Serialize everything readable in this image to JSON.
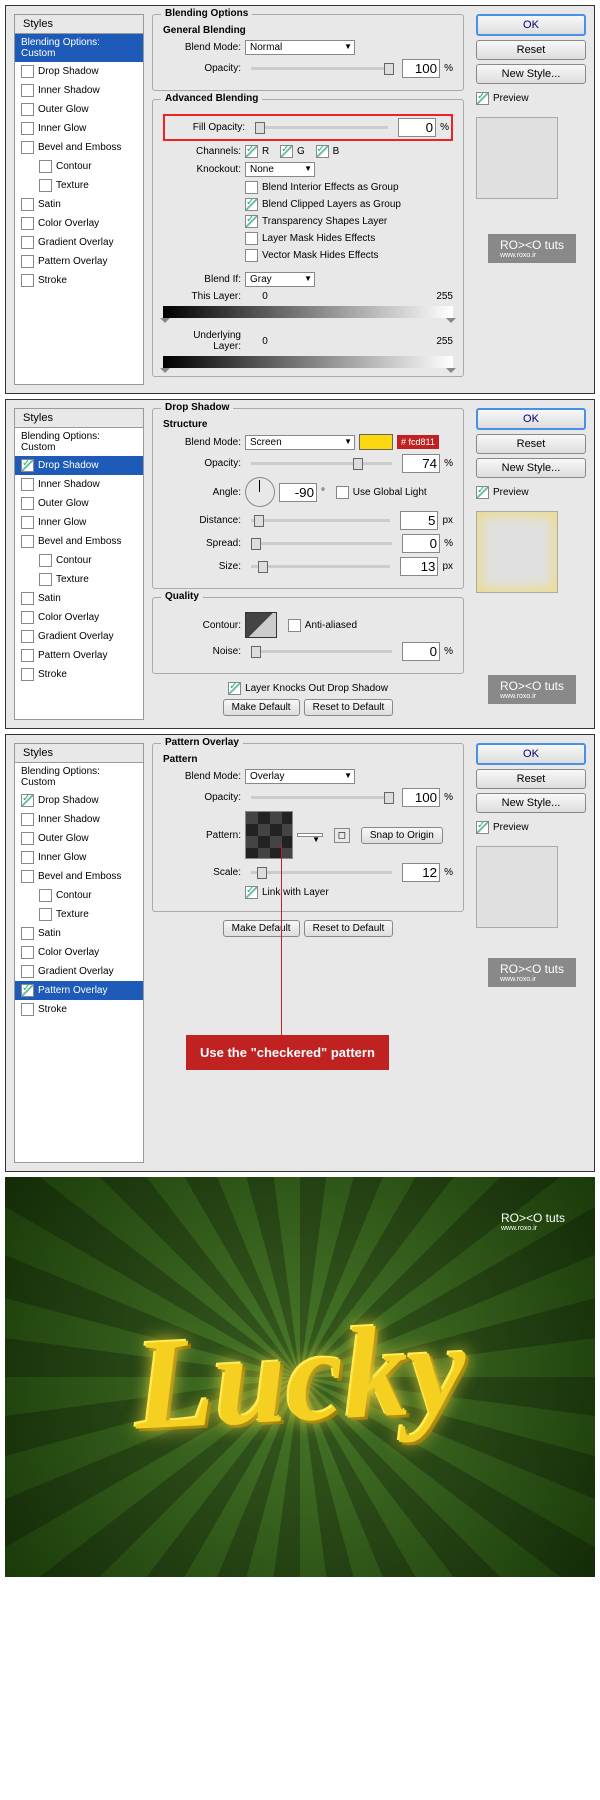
{
  "sidebar": {
    "header": "Styles",
    "items": [
      {
        "label": "Blending Options: Custom"
      },
      {
        "label": "Drop Shadow"
      },
      {
        "label": "Inner Shadow"
      },
      {
        "label": "Outer Glow"
      },
      {
        "label": "Inner Glow"
      },
      {
        "label": "Bevel and Emboss"
      },
      {
        "label": "Contour"
      },
      {
        "label": "Texture"
      },
      {
        "label": "Satin"
      },
      {
        "label": "Color Overlay"
      },
      {
        "label": "Gradient Overlay"
      },
      {
        "label": "Pattern Overlay"
      },
      {
        "label": "Stroke"
      }
    ]
  },
  "buttons": {
    "ok": "OK",
    "reset": "Reset",
    "newStyle": "New Style...",
    "preview": "Preview",
    "makeDef": "Make Default",
    "resetDef": "Reset to Default",
    "snap": "Snap to Origin"
  },
  "p1": {
    "t1": "Blending Options",
    "t2": "General Blending",
    "t3": "Advanced Blending",
    "blendMode": "Blend Mode:",
    "bmVal": "Normal",
    "opacity": "Opacity:",
    "opVal": "100",
    "pct": "%",
    "fillOp": "Fill Opacity:",
    "fillVal": "0",
    "channels": "Channels:",
    "r": "R",
    "g": "G",
    "b": "B",
    "knockout": "Knockout:",
    "koVal": "None",
    "c1": "Blend Interior Effects as Group",
    "c2": "Blend Clipped Layers as Group",
    "c3": "Transparency Shapes Layer",
    "c4": "Layer Mask Hides Effects",
    "c5": "Vector Mask Hides Effects",
    "blendIf": "Blend If:",
    "biVal": "Gray",
    "thisLayer": "This Layer:",
    "tl0": "0",
    "tl1": "255",
    "under": "Underlying Layer:",
    "ul0": "0",
    "ul1": "255"
  },
  "p2": {
    "t1": "Drop Shadow",
    "t2": "Structure",
    "t3": "Quality",
    "blendMode": "Blend Mode:",
    "bmVal": "Screen",
    "swatchHex": "# fcd811",
    "opacity": "Opacity:",
    "opVal": "74",
    "angle": "Angle:",
    "angVal": "-90",
    "deg": "°",
    "ugl": "Use Global Light",
    "distance": "Distance:",
    "dVal": "5",
    "px": "px",
    "spread": "Spread:",
    "spVal": "0",
    "size": "Size:",
    "szVal": "13",
    "contour": "Contour:",
    "aa": "Anti-aliased",
    "noise": "Noise:",
    "nVal": "0",
    "knock": "Layer Knocks Out Drop Shadow"
  },
  "p3": {
    "t1": "Pattern Overlay",
    "t2": "Pattern",
    "blendMode": "Blend Mode:",
    "bmVal": "Overlay",
    "opacity": "Opacity:",
    "opVal": "100",
    "pattern": "Pattern:",
    "scale": "Scale:",
    "scVal": "12",
    "link": "Link with Layer",
    "callout": "Use the \"checkered\" pattern"
  },
  "wm": {
    "brand": "RO><O tuts",
    "url": "www.roxo.ir"
  },
  "result": {
    "text": "Lucky"
  }
}
